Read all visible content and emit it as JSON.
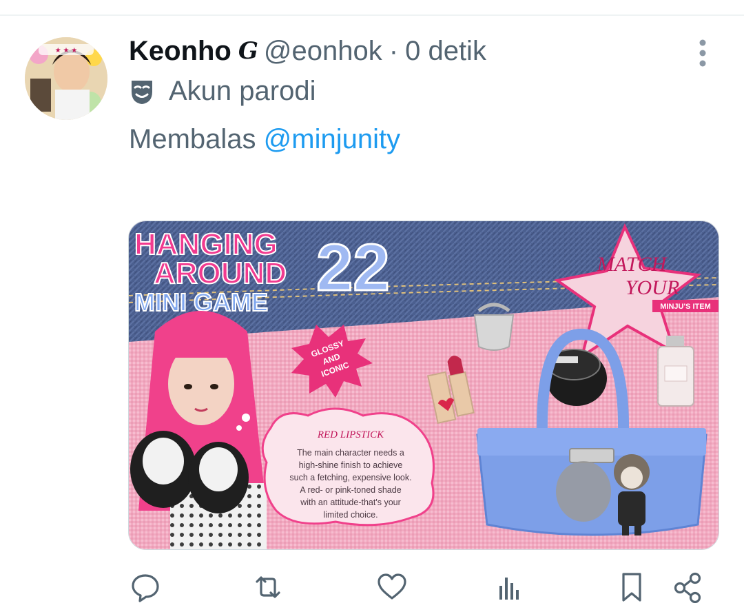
{
  "tweet": {
    "author_name": "Keonho",
    "badge_glyph": "G",
    "handle": "@eonhok",
    "separator": "·",
    "time": "0 detik",
    "parody_label": "Akun parodi",
    "reply_prefix": "Membalas",
    "reply_to": "@minjunity"
  },
  "media": {
    "title_line1": "HANGING",
    "title_line2": "AROUND",
    "title_line3": "MINI GAME",
    "title_number": "22",
    "star_line1": "MATCH",
    "star_line2": "YOUR",
    "star_line3": "MINJU'S ITEM",
    "burst_line1": "GLOSSY",
    "burst_line2": "AND",
    "burst_line3": "ICONIC",
    "bubble_title": "RED LIPSTICK",
    "bubble_line1": "The main character needs a",
    "bubble_line2": "high-shine finish to achieve",
    "bubble_line3": "such a fetching, expensive look.",
    "bubble_line4": "A red- or pink-toned shade",
    "bubble_line5": "with an attitude-that's your",
    "bubble_line6": "limited choice."
  },
  "actions": {
    "reply": "reply-icon",
    "retweet": "retweet-icon",
    "like": "heart-icon",
    "views": "views-icon",
    "bookmark": "bookmark-icon",
    "share": "share-icon"
  },
  "colors": {
    "text_primary": "#0f1419",
    "text_secondary": "#536471",
    "link": "#1d9bf0",
    "hot_pink": "#e8317a",
    "denim": "#4a5d8c",
    "bag_blue": "#7d9fe8"
  }
}
